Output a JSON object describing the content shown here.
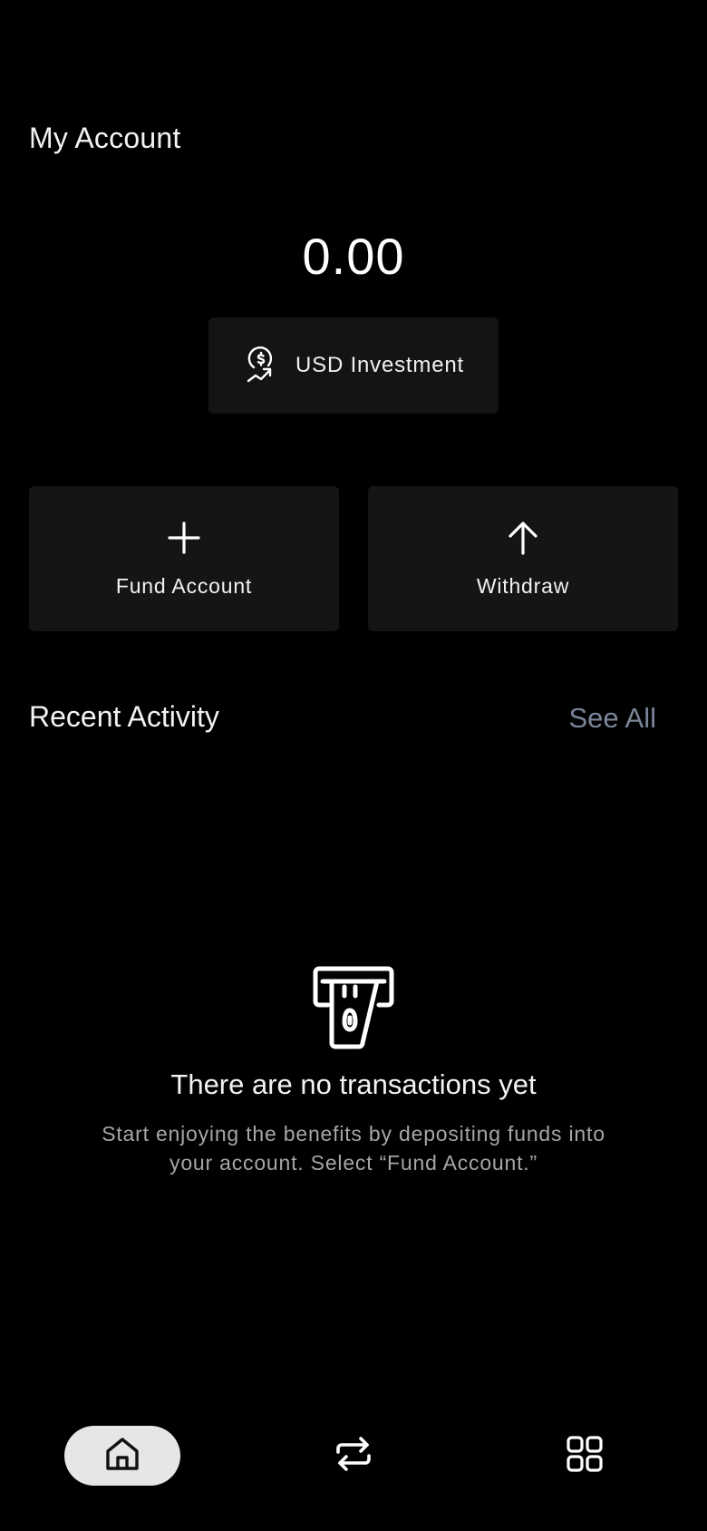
{
  "header": {
    "title": "My Account"
  },
  "balance": {
    "amount": "0.00"
  },
  "account_selector": {
    "label": "USD Investment",
    "icon": "investment-dollar-icon"
  },
  "actions": {
    "fund": {
      "label": "Fund Account",
      "icon": "plus-icon"
    },
    "withdraw": {
      "label": "Withdraw",
      "icon": "arrow-up-icon"
    }
  },
  "recent_activity": {
    "title": "Recent Activity",
    "see_all": "See All",
    "empty_state": {
      "icon": "card-withdraw-icon",
      "title": "There are no transactions yet",
      "description": "Start enjoying the benefits by depositing funds into your account. Select “Fund Account.”"
    }
  },
  "bottom_nav": {
    "items": [
      {
        "name": "home",
        "icon": "home-icon",
        "active": true
      },
      {
        "name": "transfer",
        "icon": "transfer-icon",
        "active": false
      },
      {
        "name": "apps",
        "icon": "grid-icon",
        "active": false
      }
    ]
  },
  "colors": {
    "background": "#000000",
    "card": "#151515",
    "link": "#7b8599",
    "muted_text": "#a6a6a6",
    "active_nav_bg": "#e6e6e6"
  }
}
